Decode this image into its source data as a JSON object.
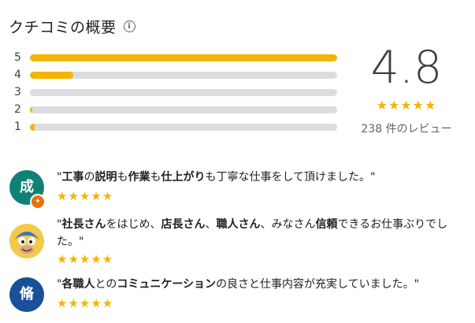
{
  "header": {
    "title": "クチコミの概要",
    "info_icon": "i"
  },
  "distribution": [
    {
      "label": "5",
      "fraction": 1.0
    },
    {
      "label": "4",
      "fraction": 0.14
    },
    {
      "label": "3",
      "fraction": 0.0
    },
    {
      "label": "2",
      "fraction": 0.008
    },
    {
      "label": "1",
      "fraction": 0.015
    }
  ],
  "summary": {
    "rating": "4.8",
    "stars": "★★★★★",
    "count": "238 件のレビュー"
  },
  "colors": {
    "accent": "#f4b400",
    "track": "#dadce0",
    "avatar1": "#0f8177",
    "avatar3": "#1a4f9a"
  },
  "reviews": [
    {
      "avatar_text": "成",
      "parts": [
        [
          "\"",
          false
        ],
        [
          "工事",
          true
        ],
        [
          "の",
          false
        ],
        [
          "説明",
          true
        ],
        [
          "も",
          false
        ],
        [
          "作業",
          true
        ],
        [
          "も",
          false
        ],
        [
          "仕上がり",
          true
        ],
        [
          "も丁寧な仕事をして頂けました。\"",
          false
        ]
      ],
      "stars": "★★★★★"
    },
    {
      "avatar_text": "",
      "parts": [
        [
          "\"",
          false
        ],
        [
          "社長さん",
          true
        ],
        [
          "をはじめ、",
          false
        ],
        [
          "店長さん",
          true
        ],
        [
          "、",
          false
        ],
        [
          "職人さん",
          true
        ],
        [
          "、みなさん",
          false
        ],
        [
          "信頼",
          true
        ],
        [
          "できるお仕事ぶりでした。\"",
          false
        ]
      ],
      "stars": "★★★★★"
    },
    {
      "avatar_text": "脩",
      "parts": [
        [
          "\"",
          false
        ],
        [
          "各職人",
          true
        ],
        [
          "との",
          false
        ],
        [
          "コミュニケーション",
          true
        ],
        [
          "の良さと仕事内容が充実していました。\"",
          false
        ]
      ],
      "stars": "★★★★★"
    }
  ]
}
